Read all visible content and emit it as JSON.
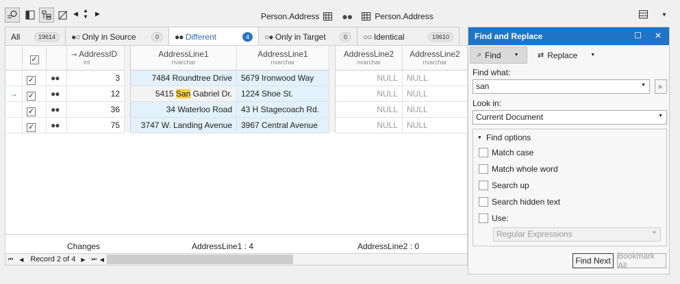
{
  "toolbar": {
    "left_object": "Person.Address",
    "right_object": "Person.Address"
  },
  "tabs": [
    {
      "label": "All",
      "count": "19614"
    },
    {
      "label": "Only in Source",
      "count": "0"
    },
    {
      "label": "Different",
      "count": "4"
    },
    {
      "label": "Only in Target",
      "count": "0"
    },
    {
      "label": "Identical",
      "count": "19610"
    }
  ],
  "columns": {
    "address_id": {
      "name": "AddressID",
      "type": "int"
    },
    "src_line1": {
      "name": "AddressLine1",
      "type": "nvarchar"
    },
    "tgt_line1": {
      "name": "AddressLine1",
      "type": "nvarchar"
    },
    "src_line2": {
      "name": "AddressLine2",
      "type": "nvarchar"
    },
    "tgt_line2": {
      "name": "AddressLine2",
      "type": "nvarchar"
    }
  },
  "rows": [
    {
      "id": "3",
      "src1": "7484 Roundtree Drive",
      "tgt1": "5679 Ironwood Way",
      "src2": "NULL",
      "tgt2": "NULL"
    },
    {
      "id": "12",
      "src1_pre": "5415 ",
      "src1_hl": "San",
      "src1_post": " Gabriel Dr.",
      "tgt1": "1224 Shoe St.",
      "src2": "NULL",
      "tgt2": "NULL"
    },
    {
      "id": "36",
      "src1": "34 Waterloo Road",
      "tgt1": "43 H Stagecoach Rd.",
      "src2": "NULL",
      "tgt2": "NULL"
    },
    {
      "id": "75",
      "src1": "3747 W. Landing Avenue",
      "tgt1": "3967 Central Avenue",
      "src2": "NULL",
      "tgt2": "NULL"
    }
  ],
  "footer": {
    "changes_label": "Changes",
    "line1_changes": "AddressLine1 : 4",
    "line2_changes": "AddressLine2 : 0"
  },
  "navigator": {
    "record_text": "Record 2 of 4"
  },
  "find_replace": {
    "title": "Find and Replace",
    "find_tab": "Find",
    "replace_tab": "Replace",
    "find_what_label": "Find what:",
    "find_what_value": "san",
    "look_in_label": "Look in:",
    "look_in_value": "Current Document",
    "find_options_label": "Find options",
    "options": [
      "Match case",
      "Match whole word",
      "Search up",
      "Search hidden text",
      "Use:"
    ],
    "use_value": "Regular Expressions",
    "find_next_label": "Find Next",
    "bookmark_all_label": "Bookmark All"
  },
  "colors": {
    "accent": "#1f74c7",
    "diff_bg": "#e2f1fb",
    "highlight": "#f7d34a"
  }
}
